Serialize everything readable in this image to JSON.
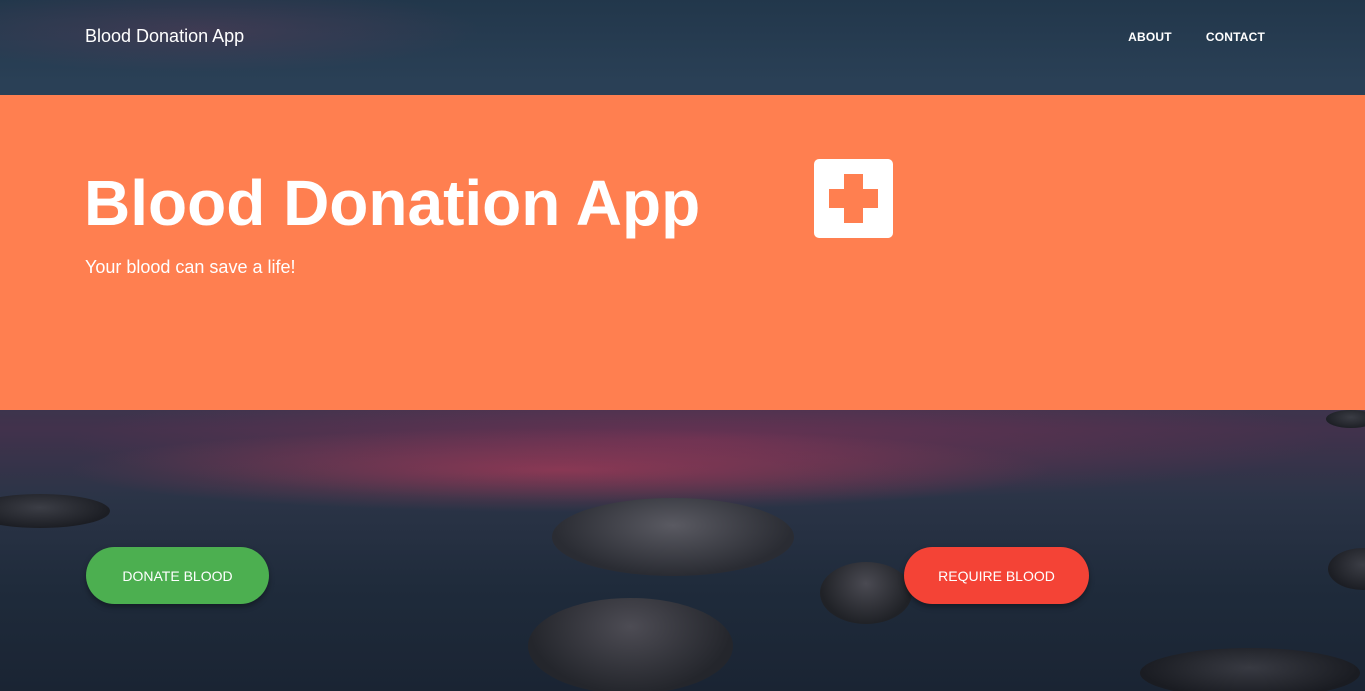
{
  "navbar": {
    "brand": "Blood Donation App",
    "links": [
      "ABOUT",
      "CONTACT"
    ]
  },
  "hero": {
    "title": "Blood Donation App",
    "subtitle": "Your blood can save a life!",
    "icon": "medical-cross-icon",
    "background_color": "#ff7f50"
  },
  "actions": {
    "donate_label": "DONATE BLOOD",
    "donate_color": "#4caf50",
    "require_label": "REQUIRE BLOOD",
    "require_color": "#f44336"
  }
}
